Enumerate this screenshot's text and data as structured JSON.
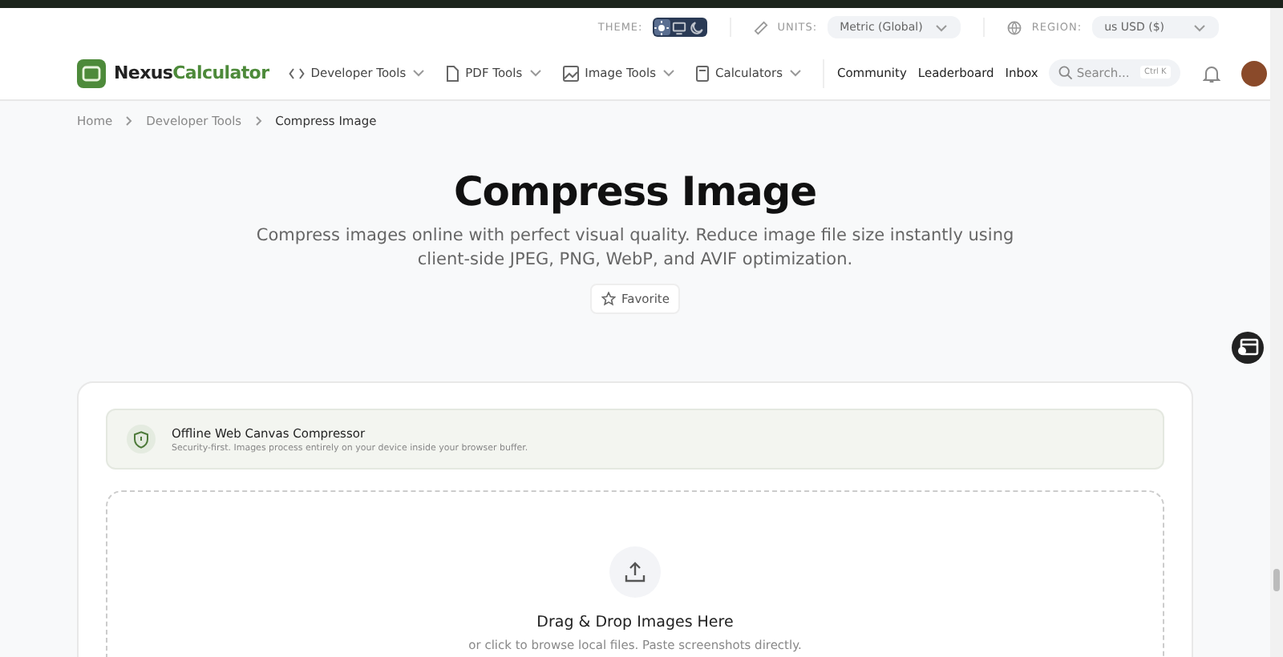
{
  "utility_bar": {
    "theme_label": "THEME:",
    "theme_options": [
      {
        "kind": "sun",
        "selected": true
      },
      {
        "kind": "monitor",
        "selected": false
      },
      {
        "kind": "moon",
        "selected": false
      }
    ],
    "units_label": "UNITS:",
    "units_value": "Metric (Global)",
    "region_label": "REGION:",
    "region_value": "us USD ($)"
  },
  "nav": {
    "logo_left": "Nexus",
    "logo_right": "Calculator",
    "menus": [
      {
        "label": "Developer Tools",
        "kind": "code"
      },
      {
        "label": "PDF Tools",
        "kind": "file"
      },
      {
        "label": "Image Tools",
        "kind": "image"
      },
      {
        "label": "Calculators",
        "kind": "calculator"
      }
    ],
    "links": [
      "Community",
      "Leaderboard",
      "Inbox"
    ],
    "search": {
      "placeholder": "Search...",
      "shortcut": "Ctrl K"
    }
  },
  "breadcrumb": [
    {
      "label": "Home",
      "current": false
    },
    {
      "label": "Developer Tools",
      "current": false
    },
    {
      "label": "Compress Image",
      "current": true
    }
  ],
  "hero": {
    "title": "Compress Image",
    "subtitle": "Compress images online with perfect visual quality. Reduce image file size instantly using client-side JPEG, PNG, WebP, and AVIF optimization.",
    "favorite": "Favorite"
  },
  "notice": {
    "title": "Offline Web Canvas Compressor",
    "text": "Security-first. Images process entirely on your device inside your browser buffer."
  },
  "dropzone": {
    "title": "Drag & Drop Images Here",
    "text": "or click to browse local files. Paste screenshots directly."
  }
}
